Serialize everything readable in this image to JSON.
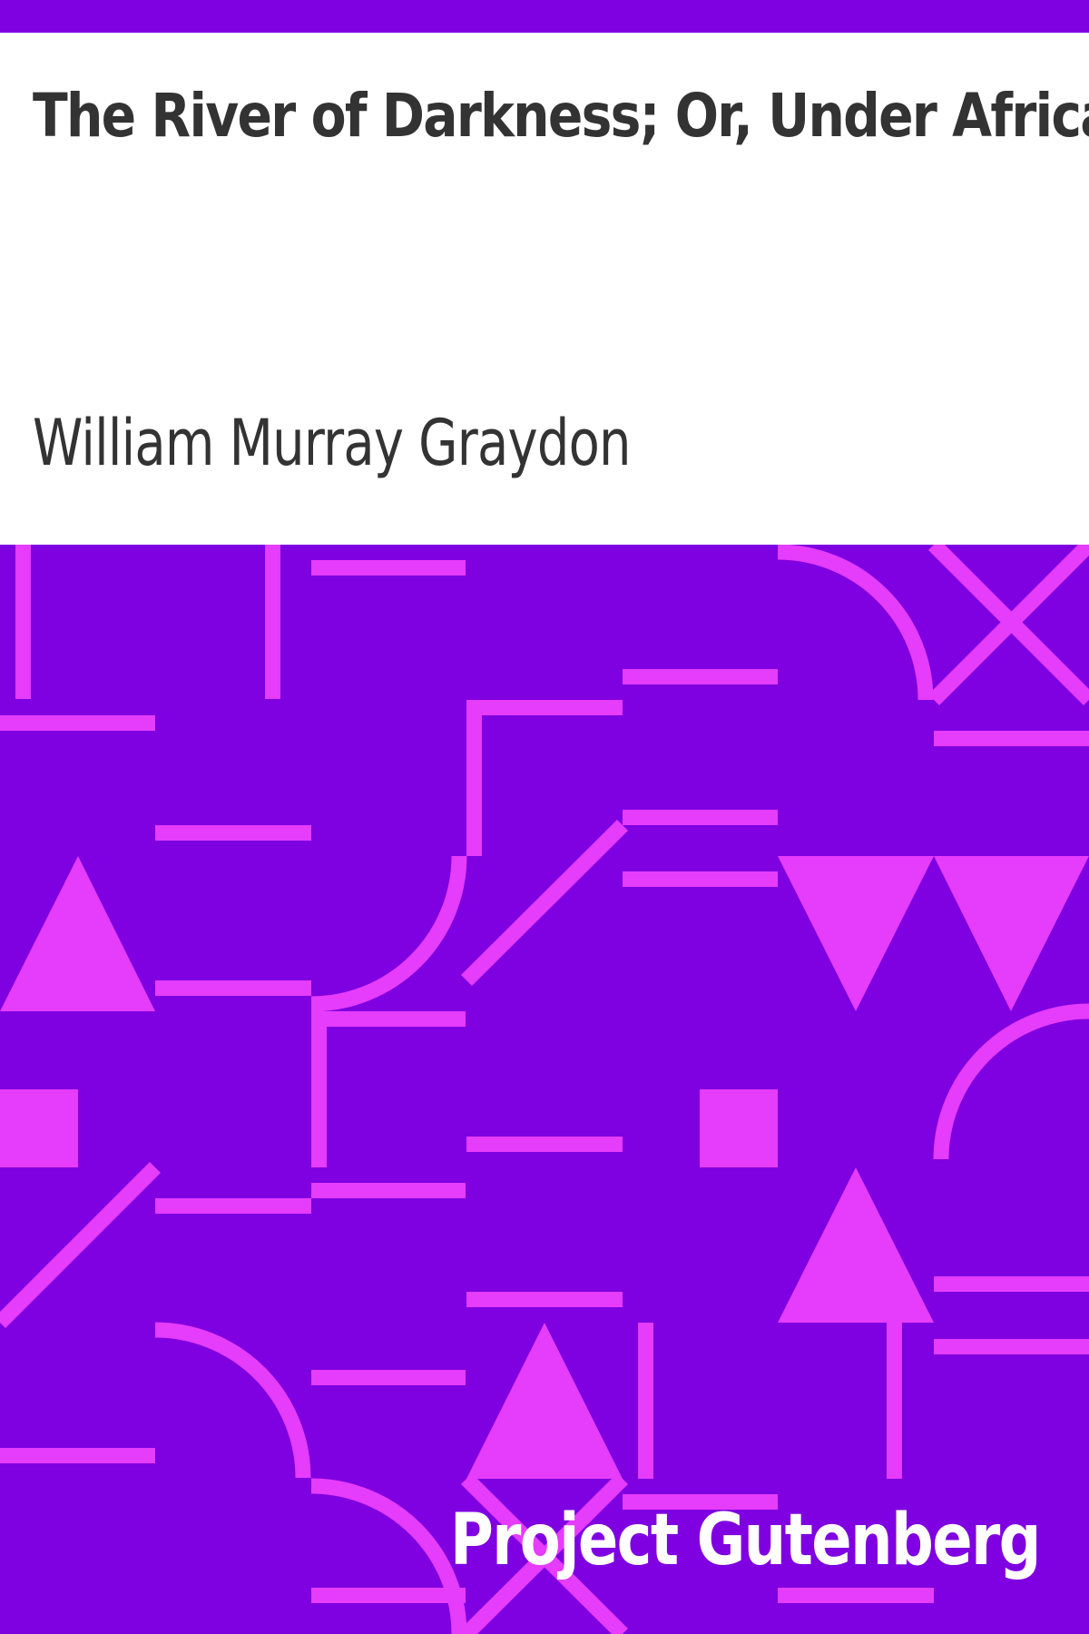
{
  "cover": {
    "title": "The River of Darkness; Or, Under Africa",
    "author": "William Murray Graydon",
    "publisher": "Project Gutenberg"
  },
  "colors": {
    "background": "#ffffff",
    "band": "#7f00e0",
    "pattern": "#e63cfb",
    "text": "#333333",
    "publisher_text": "#ffffff"
  }
}
